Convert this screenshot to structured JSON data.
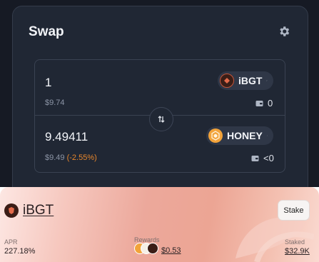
{
  "swap": {
    "title": "Swap",
    "from": {
      "amount": "1",
      "usd": "$9.74",
      "token": "iBGT",
      "balance": "0"
    },
    "to": {
      "amount": "9.49411",
      "usd": "$9.49",
      "change": "(-2.55%)",
      "token": "HONEY",
      "balance": "<0"
    }
  },
  "pool": {
    "name": "iBGT",
    "stake_label": "Stake",
    "apr_label": "APR",
    "apr_value": "227.18%",
    "rewards_label": "Rewards",
    "rewards_value": "$0.53",
    "staked_label": "Staked",
    "staked_value": "$32.9K"
  },
  "colors": {
    "background": "#161a24",
    "card": "#202734",
    "negative": "#e8872c",
    "honey": "#f2a33a",
    "ibgt": "#c4553a"
  },
  "icons": [
    "gear-icon",
    "ibgt-token-icon",
    "honey-token-icon",
    "chevron-down-icon",
    "wallet-icon",
    "swap-arrows-icon"
  ]
}
